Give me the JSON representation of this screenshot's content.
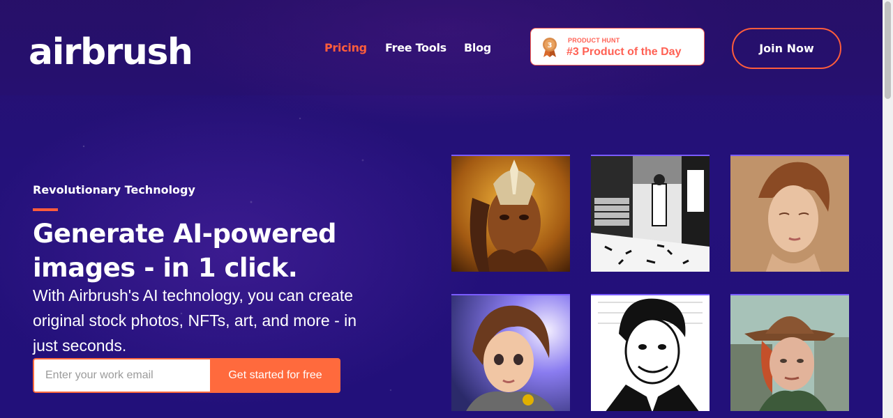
{
  "brand": {
    "logo": "airbrush"
  },
  "nav": {
    "pricing": "Pricing",
    "free_tools": "Free Tools",
    "blog": "Blog"
  },
  "product_hunt": {
    "label": "PRODUCT HUNT",
    "rank_text": "#3 Product of the Day",
    "medal_number": "3"
  },
  "header": {
    "join_label": "Join Now"
  },
  "hero": {
    "eyebrow": "Revolutionary Technology",
    "headline_line1": "Generate AI-powered",
    "headline_line2": "images - in 1 click.",
    "subtext": "With Airbrush's AI technology, you can create original stock photos, NFTs, art, and more - in just seconds."
  },
  "signup": {
    "placeholder": "Enter your work email",
    "button_label": "Get started for free"
  },
  "colors": {
    "accent": "#ff5d3b",
    "badge": "#ff6154",
    "background": "#24117a"
  },
  "gallery": {
    "count": 6
  }
}
